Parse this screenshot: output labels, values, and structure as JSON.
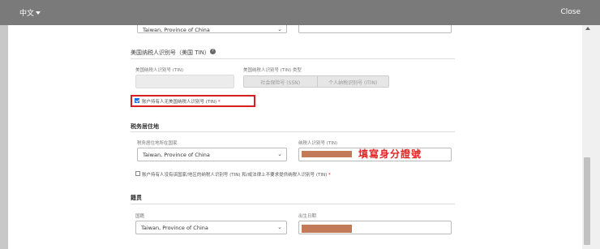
{
  "topbar": {
    "language": "中文",
    "close_label": "Close"
  },
  "top_row": {
    "country_value": "Taiwan, Province of China"
  },
  "us_tin": {
    "title": "美国纳税人识别号（美国 TIN）",
    "tin_label": "美国纳税人识别号 (TIN)",
    "tin_type_label": "美国纳税人识别号 (TIN) 类型",
    "type_options": [
      "社会保险号 (SSN)",
      "个人纳税识别号 (ITIN)"
    ],
    "no_tin_checkbox_label": "账户持有人无美国纳税人识别号 (TIN)",
    "no_tin_checked": true
  },
  "tax_residence": {
    "title": "税务居住地",
    "country_label": "税务居住地所在国家",
    "country_value": "Taiwan, Province of China",
    "tin_label": "纳税人识别号 (TIN)",
    "annotation": "填寫身分證號",
    "no_tin_checkbox_label": "账户持有人没有该国家/地区的纳税人识别号 (TIN) 和/或法律上不要求提供纳税人识别号 (TIN)",
    "no_tin_checked": false
  },
  "citizenship": {
    "title": "籍贯",
    "nationality_label": "国籍",
    "nationality_value": "Taiwan, Province of China",
    "dob_label": "出生日期"
  },
  "colors": {
    "accent": "#1a73e8",
    "highlight": "#d81e1e",
    "redaction": "#c27a58"
  }
}
